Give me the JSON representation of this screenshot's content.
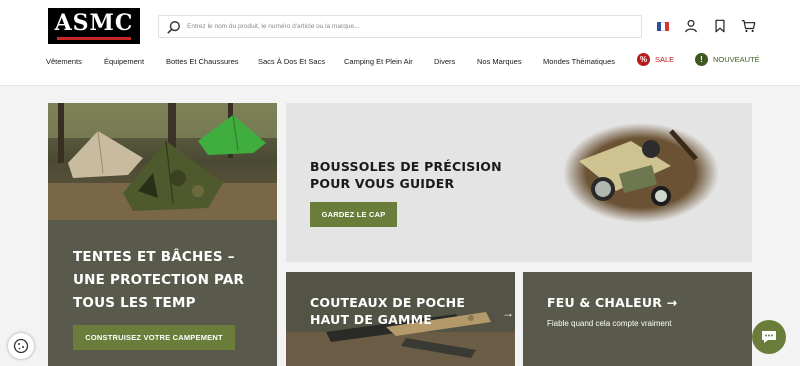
{
  "brand": {
    "logo_text": "ASMC"
  },
  "search": {
    "placeholder": "Entrez le nom du produit, le numéro d'article ou la marque..."
  },
  "header_icons": [
    "flag-france-icon",
    "user-icon",
    "bookmark-icon",
    "cart-icon"
  ],
  "nav": {
    "items": [
      "Vêtements",
      "Équipement",
      "Bottes Et Chaussures",
      "Sacs À Dos Et Sacs",
      "Camping Et Plein Air",
      "Divers",
      "Nos Marques",
      "Mondes Thématiques"
    ],
    "sale_label": "SALE",
    "new_label": "NOUVEAUTÉ"
  },
  "tiles": {
    "tents": {
      "title": "TENTES ET BÂCHES – UNE PROTECTION PAR TOUS LES TEMP",
      "button": "CONSTRUISEZ VOTRE CAMPEMENT"
    },
    "compass": {
      "title": "BOUSSOLES DE PRÉCISION POUR VOUS GUIDER",
      "button": "GARDEZ LE CAP"
    },
    "knives": {
      "title": "COUTEAUX DE POCHE HAUT DE GAMME"
    },
    "fire": {
      "title": "FEU & CHALEUR →",
      "subtitle": "Fiable quand cela compte vraiment"
    }
  },
  "colors": {
    "accent_green": "#6b7d3a",
    "tile_dark": "#5a5a4c",
    "tile_light": "#e4e4e4",
    "sale_red": "#b71c1c",
    "new_green": "#4a6b2a"
  }
}
